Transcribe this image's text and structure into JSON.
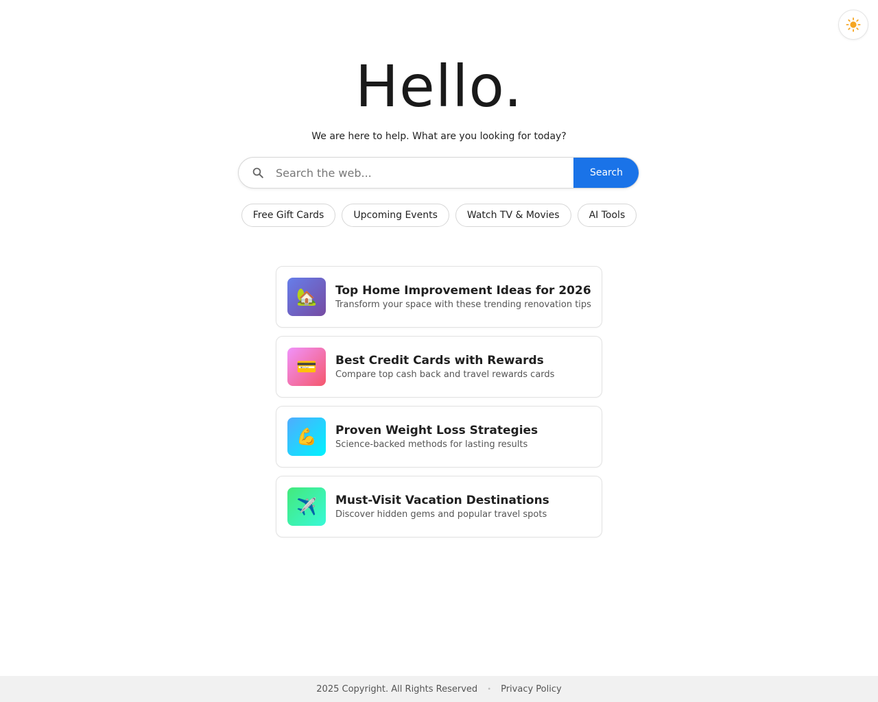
{
  "hero": {
    "title": "Hello.",
    "subtitle": "We are here to help. What are you looking for today?"
  },
  "search": {
    "placeholder": "Search the web...",
    "value": "",
    "button_label": "Search"
  },
  "chips": [
    {
      "label": "Free Gift Cards"
    },
    {
      "label": "Upcoming Events"
    },
    {
      "label": "Watch TV & Movies"
    },
    {
      "label": "AI Tools"
    }
  ],
  "cards": [
    {
      "icon": "house-icon",
      "emoji": "🏡",
      "title": "Top Home Improvement Ideas for 2026",
      "description": "Transform your space with these trending renovation tips",
      "gradient": [
        "#667eea",
        "#764ba2"
      ]
    },
    {
      "icon": "credit-card-icon",
      "emoji": "💳",
      "title": "Best Credit Cards with Rewards",
      "description": "Compare top cash back and travel rewards cards",
      "gradient": [
        "#f093fb",
        "#f5576c"
      ]
    },
    {
      "icon": "flexed-biceps-icon",
      "emoji": "💪",
      "title": "Proven Weight Loss Strategies",
      "description": "Science-backed methods for lasting results",
      "gradient": [
        "#4facfe",
        "#00f2fe"
      ]
    },
    {
      "icon": "airplane-icon",
      "emoji": "✈️",
      "title": "Must-Visit Vacation Destinations",
      "description": "Discover hidden gems and popular travel spots",
      "gradient": [
        "#43e97b",
        "#38f9d7"
      ]
    }
  ],
  "footer": {
    "copyright": "2025 Copyright. All Rights Reserved",
    "separator": "•",
    "privacy_label": "Privacy Policy"
  },
  "colors": {
    "accent": "#1a73e8",
    "sun": "#f5a623"
  }
}
